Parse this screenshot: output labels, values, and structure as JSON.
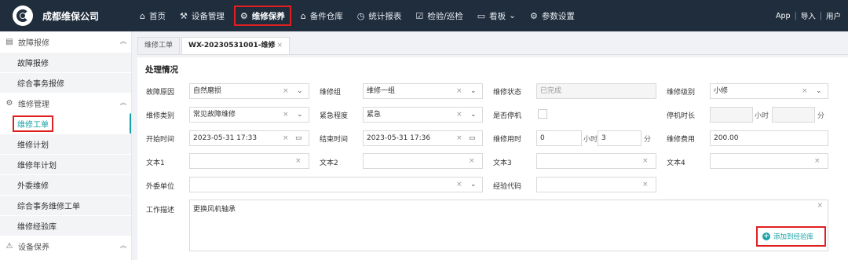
{
  "app": {
    "company": "成都维保公司"
  },
  "nav": [
    {
      "label": "首页",
      "icon": "home-icon",
      "glyph": "⌂"
    },
    {
      "label": "设备管理",
      "icon": "device-icon",
      "glyph": "⚒"
    },
    {
      "label": "维修保养",
      "icon": "maintenance-icon",
      "glyph": "⚙"
    },
    {
      "label": "备件仓库",
      "icon": "warehouse-icon",
      "glyph": "⌂"
    },
    {
      "label": "统计报表",
      "icon": "clock-icon",
      "glyph": "◷"
    },
    {
      "label": "检验/巡检",
      "icon": "inspection-icon",
      "glyph": "☑"
    },
    {
      "label": "看板",
      "icon": "board-icon",
      "glyph": "▭",
      "caret": "⌄"
    },
    {
      "label": "参数设置",
      "icon": "gear-icon",
      "glyph": "⚙"
    }
  ],
  "top_right": {
    "app": "App",
    "sep": "|",
    "import": "导入",
    "user": "用户"
  },
  "sidebar": {
    "group1": {
      "label": "故障报修",
      "caret": "︽"
    },
    "group1_items": [
      "故障报修",
      "综合事务报修"
    ],
    "group2": {
      "label": "维修管理",
      "caret": "︽"
    },
    "group2_items": [
      "维修工单",
      "维修计划",
      "维修年计划",
      "外委维修",
      "综合事务维修工单",
      "维修经验库"
    ],
    "group3": {
      "label": "设备保养",
      "caret": "︽"
    }
  },
  "tabs": [
    {
      "label": "维修工单"
    },
    {
      "label": "WX-20230531001-维修",
      "close": "×"
    }
  ],
  "form": {
    "title": "处理情况",
    "fault_reason": {
      "label": "故障原因",
      "value": "自然磨损"
    },
    "repair_group": {
      "label": "维修组",
      "value": "维修一组"
    },
    "repair_status": {
      "label": "维修状态",
      "value": "已完成"
    },
    "repair_level": {
      "label": "维修级别",
      "value": "小修"
    },
    "repair_type": {
      "label": "维修类别",
      "value": "常见故障维修"
    },
    "urgency": {
      "label": "紧急程度",
      "value": "紧急"
    },
    "shutdown": {
      "label": "是否停机"
    },
    "shutdown_duration": {
      "label": "停机时长",
      "unit_h": "小时",
      "unit_m": "分"
    },
    "start_time": {
      "label": "开始时间",
      "value": "2023-05-31 17:33"
    },
    "end_time": {
      "label": "结束时间",
      "value": "2023-05-31 17:36"
    },
    "repair_duration": {
      "label": "维修用时",
      "hours": "0",
      "unit_h": "小时",
      "minutes": "3",
      "unit_m": "分"
    },
    "repair_cost": {
      "label": "维修费用",
      "value": "200.00"
    },
    "text1": {
      "label": "文本1"
    },
    "text2": {
      "label": "文本2"
    },
    "text3": {
      "label": "文本3"
    },
    "text4": {
      "label": "文本4"
    },
    "outsource": {
      "label": "外委单位"
    },
    "exp_code": {
      "label": "经验代码"
    },
    "work_desc": {
      "label": "工作描述",
      "value": "更换风机轴承"
    },
    "add_button": {
      "label": "添加到经验库",
      "glyph": "+"
    },
    "clear_glyph": "×",
    "dropdown_glyph": "⌄",
    "calendar_glyph": "▭"
  },
  "colors": {
    "topbar": "#1f2d3d",
    "accent": "#17a2a8",
    "highlight": "#e02020"
  }
}
